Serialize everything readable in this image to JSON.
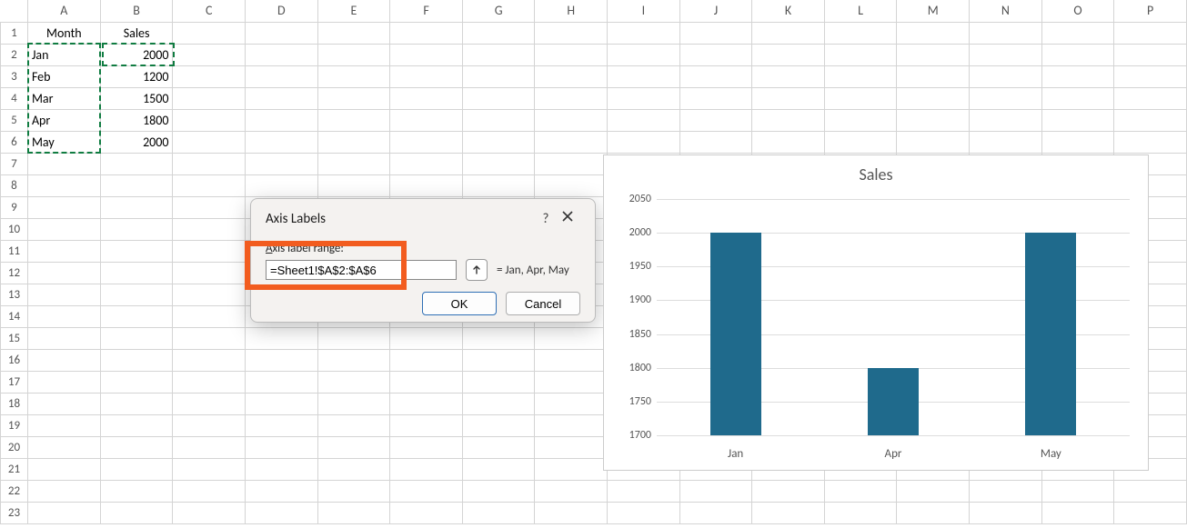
{
  "columns": [
    "A",
    "B",
    "C",
    "D",
    "E",
    "F",
    "G",
    "H",
    "I",
    "J",
    "K",
    "L",
    "M",
    "N",
    "O",
    "P"
  ],
  "row_count": 23,
  "headers": {
    "A": "Month",
    "B": "Sales"
  },
  "data_rows": [
    {
      "month": "Jan",
      "sales": "2000"
    },
    {
      "month": "Feb",
      "sales": "1200"
    },
    {
      "month": "Mar",
      "sales": "1500"
    },
    {
      "month": "Apr",
      "sales": "1800"
    },
    {
      "month": "May",
      "sales": "2000"
    }
  ],
  "dialog": {
    "title": "Axis Labels",
    "help": "?",
    "field_label_pre": "A",
    "field_label_rest": "xis label range:",
    "range_value": "=Sheet1!$A$2:$A$6",
    "preview": "= Jan, Apr, May",
    "ok": "OK",
    "cancel": "Cancel"
  },
  "chart_data": {
    "type": "bar",
    "title": "Sales",
    "categories": [
      "Jan",
      "Apr",
      "May"
    ],
    "values": [
      2000,
      1800,
      2000
    ],
    "ylim": [
      1700,
      2050
    ],
    "yticks": [
      1700,
      1750,
      1800,
      1850,
      1900,
      1950,
      2000,
      2050
    ],
    "bar_color": "#1f6a8c"
  }
}
